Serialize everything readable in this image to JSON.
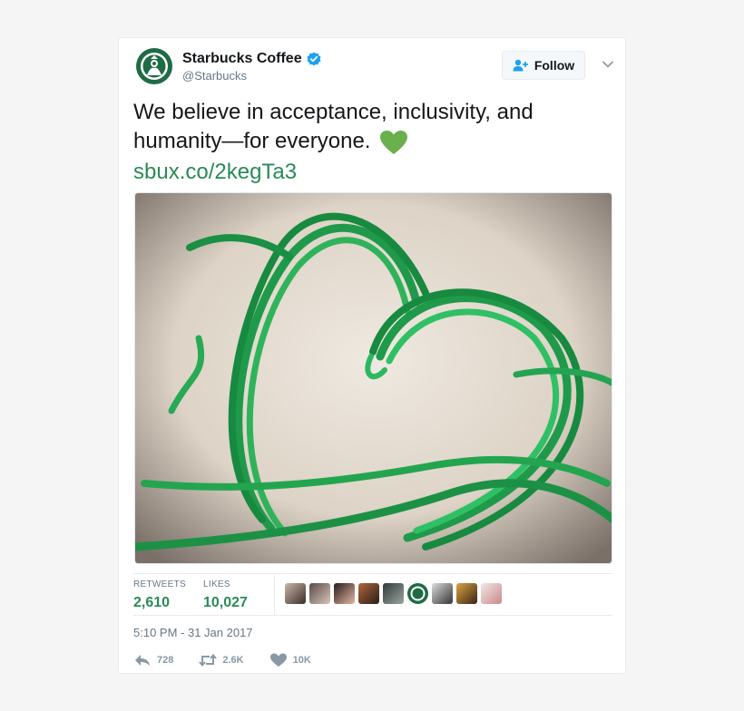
{
  "colors": {
    "accent": "#2a8a56",
    "heart": "#6ab04c",
    "text": "#14171a",
    "muted": "#657786"
  },
  "author": {
    "name": "Starbucks Coffee",
    "handle": "@Starbucks",
    "verified_icon": "verified-badge-icon",
    "avatar_icon": "starbucks-siren-logo"
  },
  "follow_button": {
    "label": "Follow",
    "icon": "add-user-icon"
  },
  "tweet": {
    "text_line1": "We believe in acceptance, inclusivity, and",
    "text_line2": "humanity—for everyone.",
    "emoji": "green-heart-icon",
    "link": "sbux.co/2kegTa3",
    "image": "green ribbons arranged in a heart shape"
  },
  "stats": {
    "retweets_label": "RETWEETS",
    "retweets_value": "2,610",
    "likes_label": "LIKES",
    "likes_value": "10,027"
  },
  "timestamp": "5:10 PM - 31 Jan 2017",
  "actions": {
    "reply_count": "728",
    "retweet_count": "2.6K",
    "like_count": "10K"
  }
}
